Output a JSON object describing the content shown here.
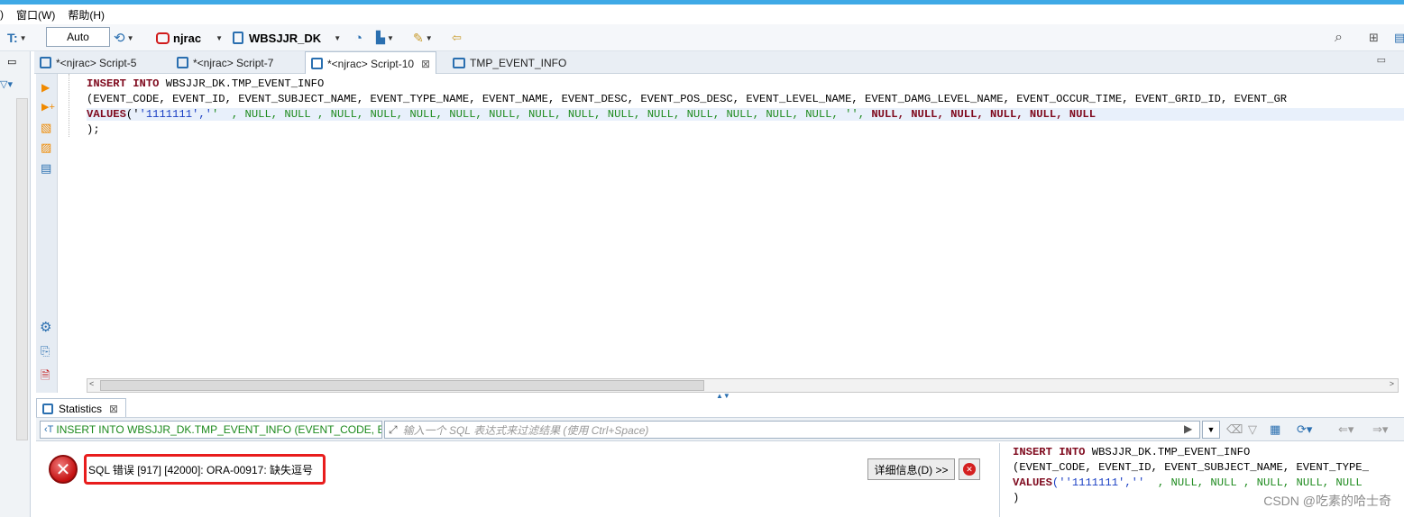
{
  "menu": {
    "items": [
      ")",
      "窗口(W)",
      "帮助(H)"
    ]
  },
  "toolbar": {
    "auto_value": "Auto",
    "connection": "njrac",
    "schema": "WBSJJR_DK"
  },
  "tabs": [
    {
      "label": "*<njrac> Script-5",
      "active": false
    },
    {
      "label": "*<njrac> Script-7",
      "active": false
    },
    {
      "label": "*<njrac> Script-10",
      "active": true
    },
    {
      "label": "TMP_EVENT_INFO",
      "active": false
    }
  ],
  "editor": {
    "line1_kw": "INSERT INTO",
    "line1_rest": " WBSJJR_DK.TMP_EVENT_INFO",
    "line2": "(EVENT_CODE, EVENT_ID, EVENT_SUBJECT_NAME, EVENT_TYPE_NAME, EVENT_NAME, EVENT_DESC, EVENT_POS_DESC, EVENT_LEVEL_NAME, EVENT_DAMG_LEVEL_NAME, EVENT_OCCUR_TIME, EVENT_GRID_ID, EVENT_GR",
    "line3_kw": "VALUES",
    "line3_paren": "('",
    "line3_str": "'1111111','",
    "line3_green": "'  , NULL, NULL , NULL, NULL, NULL, NULL, NULL, NULL, NULL, NULL, NULL, NULL, NULL, NULL, NULL, '',",
    "line3_red": " NULL, NULL, NULL, NULL, NULL, NULL",
    "line4": ");"
  },
  "results": {
    "tab_label": "Statistics",
    "query_text": "INSERT INTO WBSJJR_DK.TMP_EVENT_INFO (EVENT_CODE, E",
    "filter_placeholder": "输入一个 SQL 表达式来过滤结果 (使用 Ctrl+Space)",
    "error_message": "SQL 错误 [917] [42000]: ORA-00917: 缺失逗号",
    "detail_button": "详细信息(D) >>",
    "sql_line1_kw": "INSERT INTO",
    "sql_line1_rest": " WBSJJR_DK.TMP_EVENT_INFO",
    "sql_line2": "(EVENT_CODE, EVENT_ID, EVENT_SUBJECT_NAME, EVENT_TYPE_",
    "sql_line3_kw": "VALUES",
    "sql_line3_str": "(''1111111',''",
    "sql_line3_green": "  , NULL, NULL , NULL, NULL, NULL",
    "sql_line4": ")"
  },
  "watermark": "CSDN @吃素的哈士奇",
  "colors": {
    "accent": "#3fa9e6",
    "error": "#e81d1d",
    "keyword": "#7f0a1e",
    "string": "#1a3fc4",
    "value": "#1d8a1d"
  }
}
